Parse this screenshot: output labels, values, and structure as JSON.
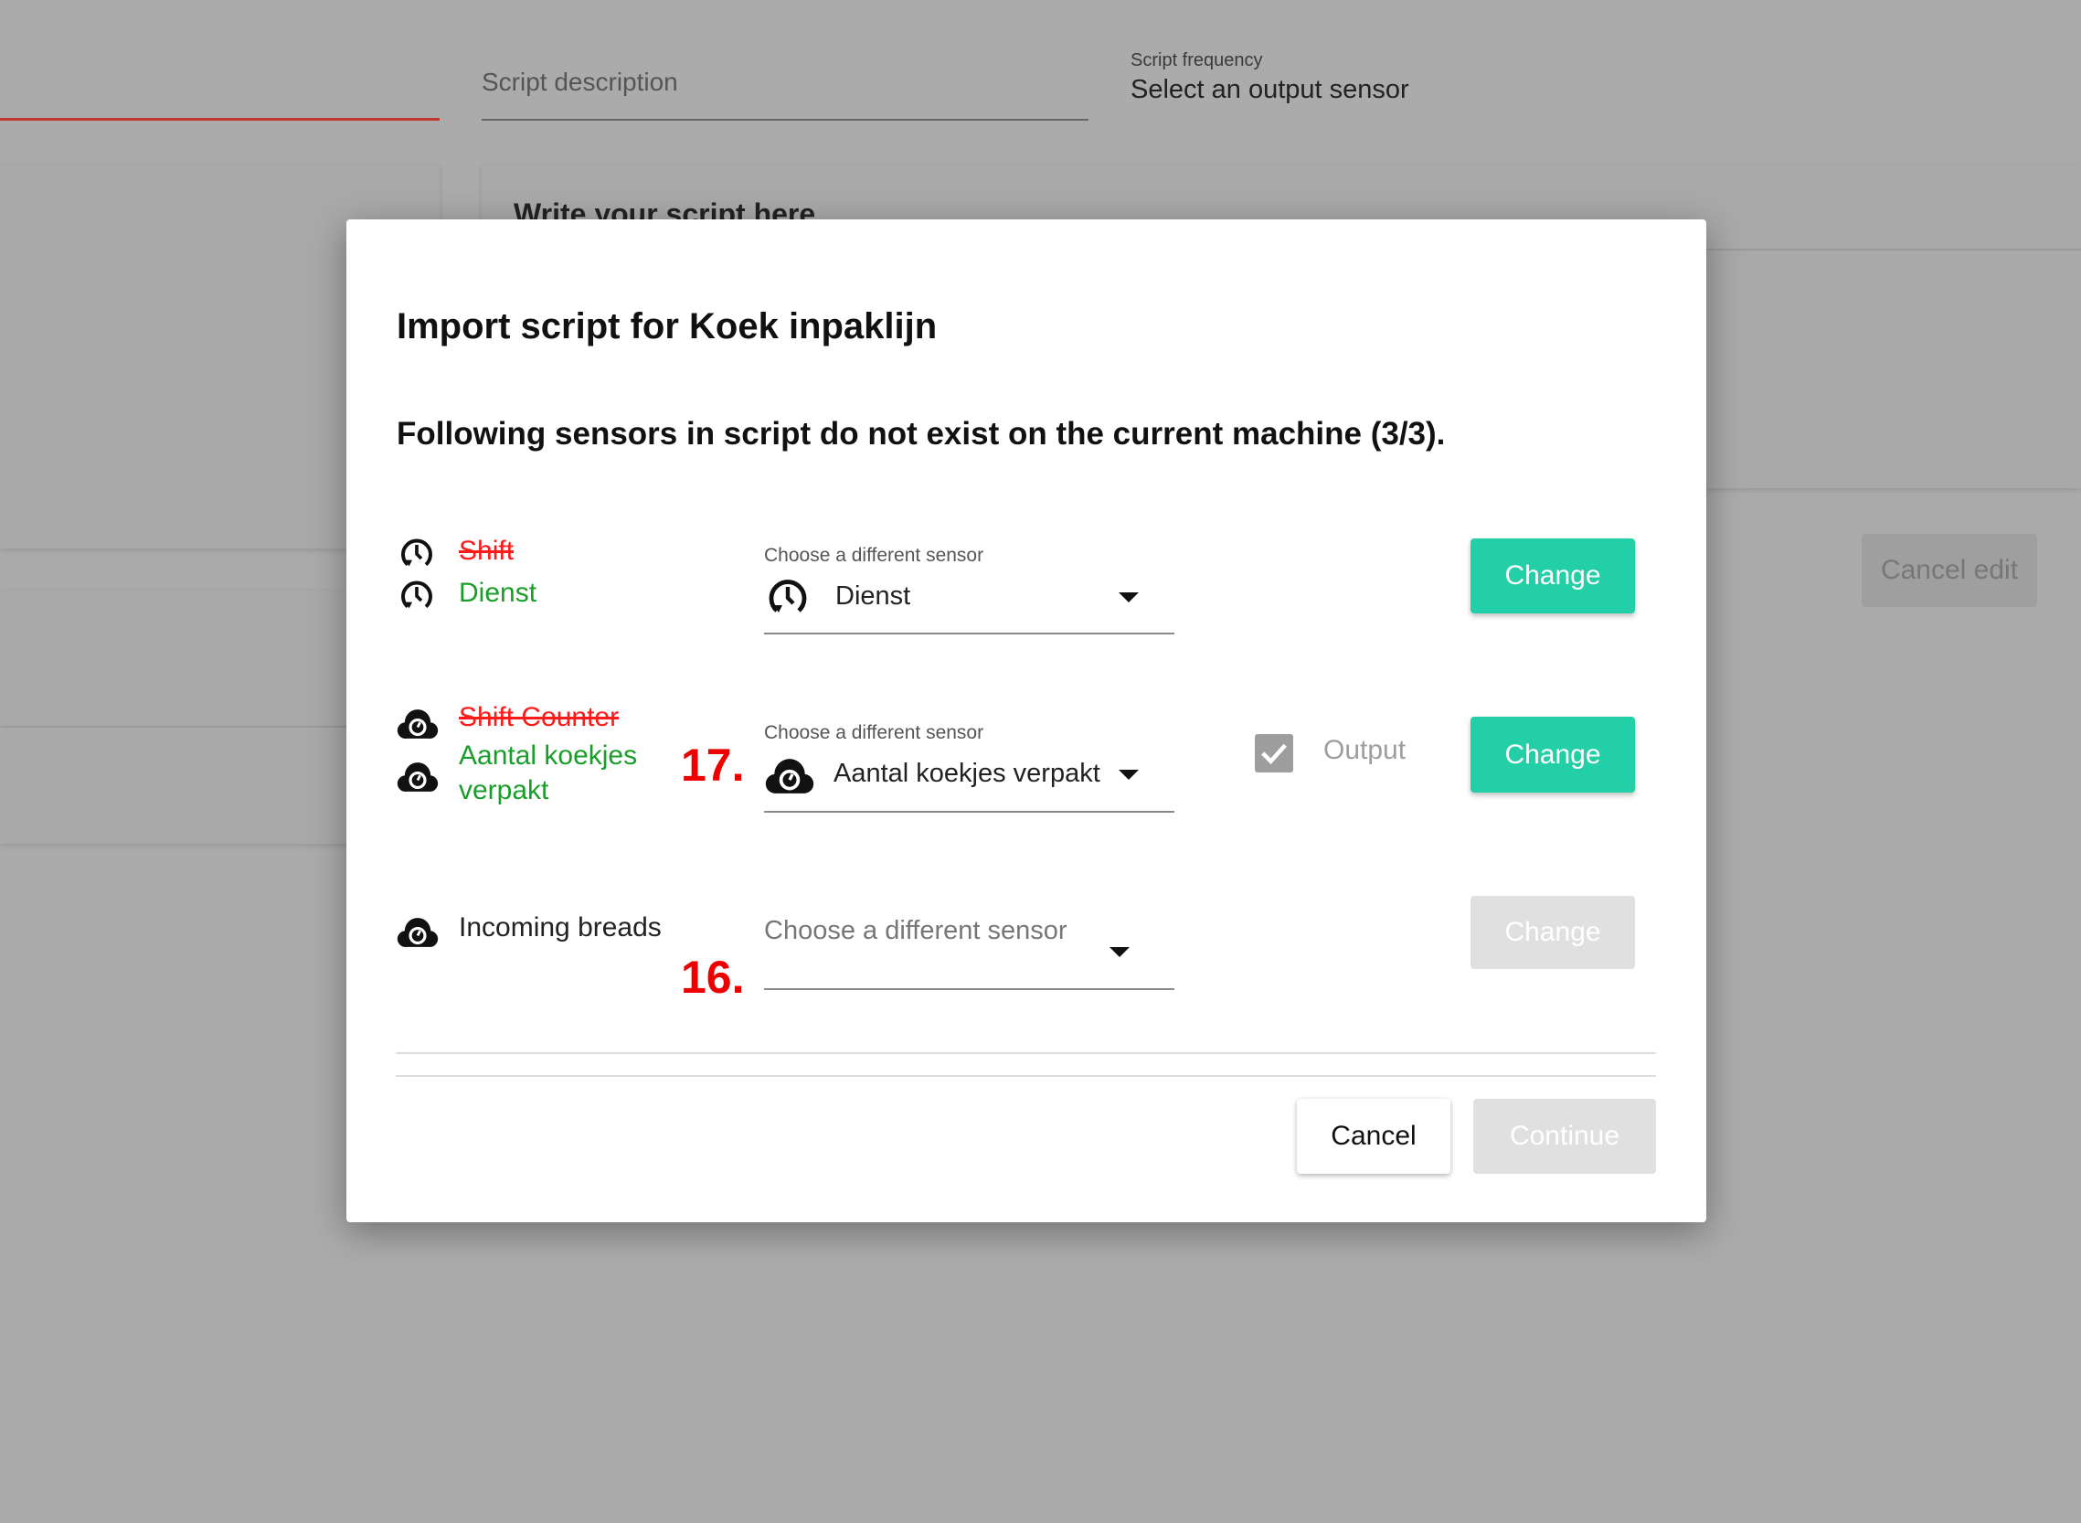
{
  "background": {
    "script_description_placeholder": "Script description",
    "script_frequency_label": "Script frequency",
    "script_frequency_value": "Select an output sensor",
    "editor_heading": "Write your script here",
    "cancel_edit_label": "Cancel edit"
  },
  "dialog": {
    "title": "Import script for Koek inpaklijn",
    "subtitle": "Following sensors in script do not exist on the current machine (3/3).",
    "rows": [
      {
        "icon": "clock-refresh-icon",
        "old_name": "Shift",
        "new_name": "Dienst",
        "select_label": "Choose a different sensor",
        "select_value": "Dienst",
        "change_label": "Change",
        "change_enabled": true
      },
      {
        "icon": "cloud-gauge-icon",
        "old_name": "Shift Counter",
        "new_name": "Aantal koekjes verpakt",
        "select_label": "Choose a different sensor",
        "select_value": "Aantal koekjes verpakt",
        "output_label": "Output",
        "output_checked": true,
        "change_label": "Change",
        "change_enabled": true,
        "annotation": "17."
      },
      {
        "icon": "cloud-gauge-icon",
        "name": "Incoming breads",
        "select_placeholder": "Choose a different sensor",
        "change_label": "Change",
        "change_enabled": false,
        "annotation": "16."
      }
    ],
    "cancel_label": "Cancel",
    "continue_label": "Continue"
  },
  "colors": {
    "accent": "#22cfa6",
    "removed": "#ff1a1a",
    "replacement": "#1a9e2a",
    "annotation": "#ee0000",
    "overlay": "#ababab"
  }
}
